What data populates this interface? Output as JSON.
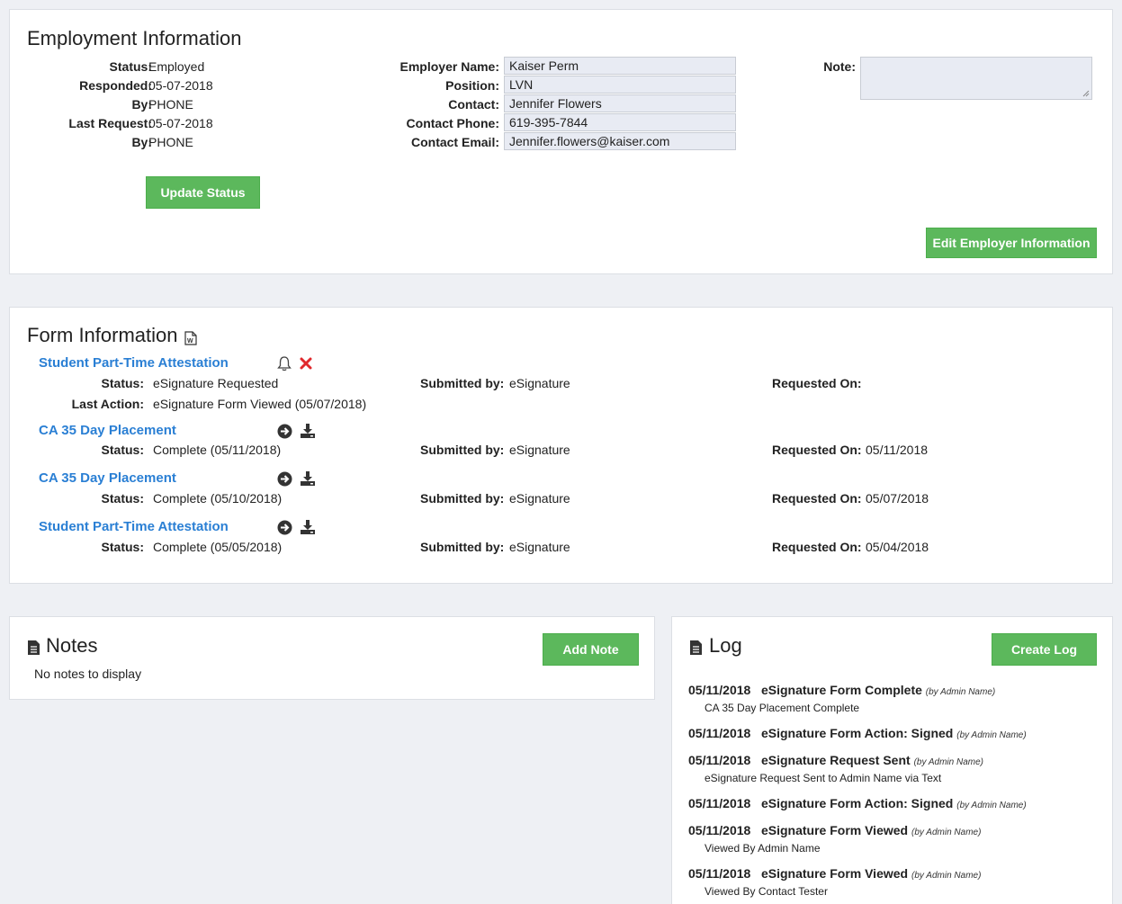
{
  "employment": {
    "title": "Employment Information",
    "status_label": "Status:",
    "status_value": "Employed",
    "responded_label": "Responded:",
    "responded_value": "05-07-2018",
    "by1_label": "By:",
    "by1_value": "PHONE",
    "last_request_label": "Last Request:",
    "last_request_value": "05-07-2018",
    "by2_label": "By:",
    "by2_value": "PHONE",
    "employer_name_label": "Employer Name:",
    "employer_name_value": "Kaiser Perm",
    "position_label": "Position:",
    "position_value": "LVN",
    "contact_label": "Contact:",
    "contact_value": "Jennifer Flowers",
    "contact_phone_label": "Contact Phone:",
    "contact_phone_value": "619-395-7844",
    "contact_email_label": "Contact Email:",
    "contact_email_value": "Jennifer.flowers@kaiser.com",
    "note_label": "Note:",
    "note_value": "",
    "update_status_button": "Update Status",
    "edit_employer_button": "Edit Employer Information"
  },
  "forms": {
    "title": "Form Information",
    "items": [
      {
        "name": "Student Part-Time Attestation",
        "status_label": "Status:",
        "status_value": "eSignature Requested",
        "last_action_label": "Last Action:",
        "last_action_value": "eSignature Form Viewed (05/07/2018)",
        "submitted_label": "Submitted by:",
        "submitted_value": "eSignature",
        "requested_label": "Requested On:",
        "requested_value": "",
        "icons": [
          "bell-icon",
          "close-x-icon"
        ]
      },
      {
        "name": "CA 35 Day Placement",
        "status_label": "Status:",
        "status_value": "Complete (05/11/2018)",
        "submitted_label": "Submitted by:",
        "submitted_value": "eSignature",
        "requested_label": "Requested On:",
        "requested_value": "05/11/2018",
        "icons": [
          "arrow-right-circle-icon",
          "download-icon"
        ]
      },
      {
        "name": "CA 35 Day Placement",
        "status_label": "Status:",
        "status_value": "Complete (05/10/2018)",
        "submitted_label": "Submitted by:",
        "submitted_value": "eSignature",
        "requested_label": "Requested On:",
        "requested_value": "05/07/2018",
        "icons": [
          "arrow-right-circle-icon",
          "download-icon"
        ]
      },
      {
        "name": "Student Part-Time Attestation",
        "status_label": "Status:",
        "status_value": "Complete (05/05/2018)",
        "submitted_label": "Submitted by:",
        "submitted_value": "eSignature",
        "requested_label": "Requested On:",
        "requested_value": "05/04/2018",
        "icons": [
          "arrow-right-circle-icon",
          "download-icon"
        ]
      }
    ]
  },
  "notes": {
    "title": "Notes",
    "add_button": "Add Note",
    "empty_text": "No notes to display"
  },
  "log": {
    "title": "Log",
    "create_button": "Create Log",
    "entries": [
      {
        "date": "05/11/2018",
        "title": "eSignature Form Complete",
        "by": "(by Admin Name)",
        "sub": "CA 35 Day Placement Complete"
      },
      {
        "date": "05/11/2018",
        "title": "eSignature Form Action: Signed",
        "by": "(by Admin Name)",
        "sub": ""
      },
      {
        "date": "05/11/2018",
        "title": "eSignature Request Sent",
        "by": "(by Admin Name)",
        "sub": "eSignature Request Sent to Admin Name via Text"
      },
      {
        "date": "05/11/2018",
        "title": "eSignature Form Action: Signed",
        "by": "(by Admin Name)",
        "sub": ""
      },
      {
        "date": "05/11/2018",
        "title": "eSignature Form Viewed",
        "by": "(by Admin Name)",
        "sub": "Viewed By Admin Name"
      },
      {
        "date": "05/11/2018",
        "title": "eSignature Form Viewed",
        "by": "(by Admin Name)",
        "sub": "Viewed By Contact Tester"
      }
    ]
  },
  "colors": {
    "accent_green": "#5cb85c",
    "link_blue": "#2a7fd4",
    "delete_red": "#e0282c"
  }
}
